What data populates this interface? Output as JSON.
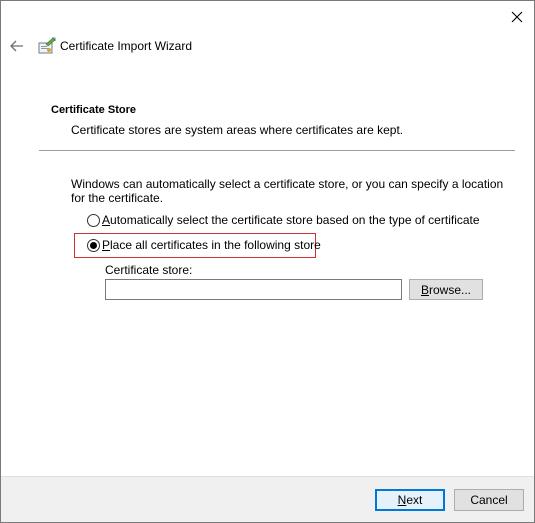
{
  "window": {
    "title": "Certificate Import Wizard"
  },
  "section": {
    "title": "Certificate Store",
    "description": "Certificate stores are system areas where certificates are kept."
  },
  "intro_text": "Windows can automatically select a certificate store, or you can specify a location for the certificate.",
  "options": [
    {
      "access_key": "A",
      "label_rest": "utomatically select the certificate store based on the type of certificate",
      "checked": false
    },
    {
      "access_key": "P",
      "label_rest": "lace all certificates in the following store",
      "checked": true
    }
  ],
  "store": {
    "label": "Certificate store:",
    "value": "",
    "browse_key": "B",
    "browse_rest": "rowse..."
  },
  "footer": {
    "next_key": "N",
    "next_rest": "ext",
    "cancel_label": "Cancel"
  },
  "colors": {
    "accent": "#0078d7",
    "highlight_border": "#d03030"
  },
  "icons": [
    "close-icon",
    "back-arrow-icon",
    "certificate-wizard-icon"
  ]
}
